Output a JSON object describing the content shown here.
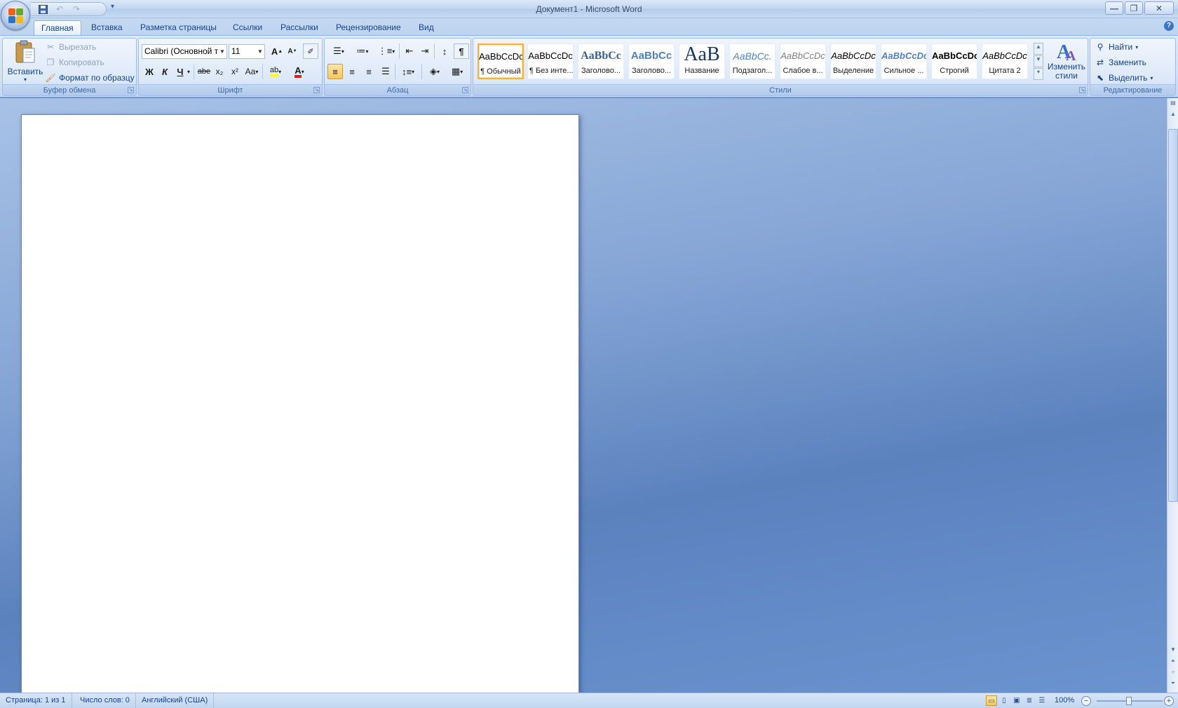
{
  "window": {
    "title": "Документ1 - Microsoft Word",
    "controls": {
      "minimize": "—",
      "maximize": "❐",
      "close": "✕"
    }
  },
  "qat": {
    "save_icon": "save-icon",
    "undo_icon": "undo-icon",
    "redo_icon": "redo-icon",
    "customize": "▾"
  },
  "tabs": [
    {
      "label": "Главная",
      "active": true
    },
    {
      "label": "Вставка"
    },
    {
      "label": "Разметка страницы"
    },
    {
      "label": "Ссылки"
    },
    {
      "label": "Рассылки"
    },
    {
      "label": "Рецензирование"
    },
    {
      "label": "Вид"
    }
  ],
  "ribbon": {
    "clipboard": {
      "label": "Буфер обмена",
      "paste": "Вставить",
      "cut": "Вырезать",
      "copy": "Копировать",
      "format_painter": "Формат по образцу"
    },
    "font": {
      "label": "Шрифт",
      "font_name": "Calibri (Основной те",
      "font_size": "11",
      "bold": "Ж",
      "italic": "К",
      "underline": "Ч",
      "strike": "abe",
      "subscript": "x₂",
      "superscript": "x²",
      "change_case": "Aa",
      "grow": "A",
      "shrink": "A",
      "font_color": "A"
    },
    "paragraph": {
      "label": "Абзац",
      "show_marks": "¶"
    },
    "styles": {
      "label": "Стили",
      "items": [
        {
          "sample": "AaBbCcDc",
          "name": "¶ Обычный",
          "selected": true
        },
        {
          "sample": "AaBbCcDc",
          "name": "¶ Без инте..."
        },
        {
          "sample": "AaBbCc",
          "name": "Заголово..."
        },
        {
          "sample": "AaBbCc",
          "name": "Заголово..."
        },
        {
          "sample": "AaB",
          "name": "Название"
        },
        {
          "sample": "AaBbCc.",
          "name": "Подзагол..."
        },
        {
          "sample": "AaBbCcDc",
          "name": "Слабое в..."
        },
        {
          "sample": "AaBbCcDc",
          "name": "Выделение"
        },
        {
          "sample": "AaBbCcDc",
          "name": "Сильное ..."
        },
        {
          "sample": "AaBbCcDc",
          "name": "Строгий"
        },
        {
          "sample": "AaBbCcDc",
          "name": "Цитата 2"
        }
      ],
      "change_styles": "Изменить стили"
    },
    "editing": {
      "label": "Редактирование",
      "find": "Найти",
      "replace": "Заменить",
      "select": "Выделить"
    }
  },
  "status": {
    "page": "Страница: 1 из 1",
    "words": "Число слов: 0",
    "language": "Английский (США)",
    "zoom": "100%",
    "zoom_level_percent": 100
  },
  "colors": {
    "accent": "#15428b",
    "highlight": "#f9c65c",
    "font_red": "#e01b1b",
    "highlight_yellow": "#ffff00"
  }
}
